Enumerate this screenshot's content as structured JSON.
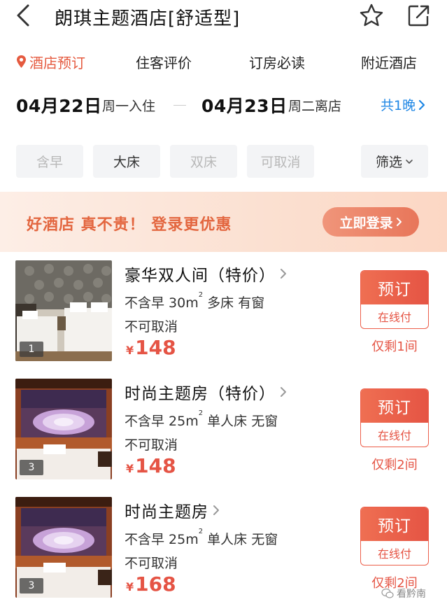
{
  "header": {
    "title": "朗琪主题酒店[舒适型]"
  },
  "tabs": [
    {
      "label": "酒店预订",
      "active": true
    },
    {
      "label": "住客评价",
      "active": false
    },
    {
      "label": "订房必读",
      "active": false
    },
    {
      "label": "附近酒店",
      "active": false
    }
  ],
  "dates": {
    "checkin_date": "04月22日",
    "checkin_label": "周一入住",
    "checkout_date": "04月23日",
    "checkout_label": "周二离店",
    "nights": "共1晚"
  },
  "filters": {
    "chips": [
      "含早",
      "大床",
      "双床",
      "可取消"
    ],
    "screen": "筛选"
  },
  "banner": {
    "text": "好酒店 真不贵！ 登录更优惠",
    "login": "立即登录"
  },
  "rooms": [
    {
      "name": "豪华双人间（特价）",
      "spec_a": "不含早 30m",
      "spec_b": " 多床 有窗",
      "cancel": "不可取消",
      "currency": "¥",
      "price": "148",
      "book": "预订",
      "pay": "在线付",
      "stock": "仅剩1间",
      "photo_count": "1"
    },
    {
      "name": "时尚主题房（特价）",
      "spec_a": "不含早 25m",
      "spec_b": " 单人床 无窗",
      "cancel": "不可取消",
      "currency": "¥",
      "price": "148",
      "book": "预订",
      "pay": "在线付",
      "stock": "仅剩2间",
      "photo_count": "3"
    },
    {
      "name": "时尚主题房",
      "spec_a": "不含早 25m",
      "spec_b": " 单人床 无窗",
      "cancel": "不可取消",
      "currency": "¥",
      "price": "168",
      "book": "预订",
      "pay": "在线付",
      "stock": "仅剩2间",
      "photo_count": "3"
    }
  ],
  "watermark": "看黔南",
  "colors": {
    "accent_red": "#e55444",
    "link_blue": "#1f87e5",
    "banner_orange": "#e3663f"
  }
}
